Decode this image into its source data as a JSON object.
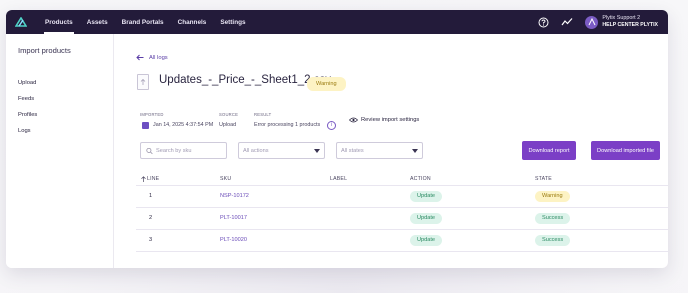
{
  "nav": {
    "items": [
      {
        "label": "Products",
        "active": true
      },
      {
        "label": "Assets",
        "active": false
      },
      {
        "label": "Brand Portals",
        "active": false
      },
      {
        "label": "Channels",
        "active": false
      },
      {
        "label": "Settings",
        "active": false
      }
    ],
    "user": {
      "name": "Plytix Support 2",
      "subtitle": "HELP CENTER PLYTIX"
    },
    "icons": [
      "help-icon",
      "activity-icon"
    ]
  },
  "sidebar": {
    "title": "Import products",
    "items": [
      {
        "label": "Upload"
      },
      {
        "label": "Feeds"
      },
      {
        "label": "Profiles"
      },
      {
        "label": "Logs"
      }
    ]
  },
  "main": {
    "back_label": "All logs",
    "file_name": "Updates_-_Price_-_Sheet1_2.csv",
    "status_badge": "Warning",
    "meta": {
      "imported_label": "IMPORTED",
      "imported_value": "Jan 14, 2025 4:37:54 PM",
      "source_label": "SOURCE",
      "source_value": "Upload",
      "result_label": "RESULT",
      "result_value": "Error processing 1 products"
    },
    "review_label": "Review import settings",
    "filters": {
      "search_placeholder": "Search by sku",
      "actions_value": "All actions",
      "states_value": "All states"
    },
    "buttons": {
      "download_report": "Download report",
      "download_file": "Download imported file"
    },
    "table": {
      "headers": {
        "line": "LINE",
        "sku": "SKU",
        "label": "LABEL",
        "action": "ACTION",
        "state": "STATE"
      },
      "rows": [
        {
          "line": "1",
          "sku": "NSP-10172",
          "label": "",
          "action": "Update",
          "state": "Warning"
        },
        {
          "line": "2",
          "sku": "PLT-10017",
          "label": "",
          "action": "Update",
          "state": "Success"
        },
        {
          "line": "3",
          "sku": "PLT-10020",
          "label": "",
          "action": "Update",
          "state": "Success"
        }
      ]
    }
  },
  "colors": {
    "nav_bg": "#231b3a",
    "accent": "#7b3fc6",
    "warning_bg": "#fdf3c4",
    "success_bg": "#dcf3ea"
  }
}
